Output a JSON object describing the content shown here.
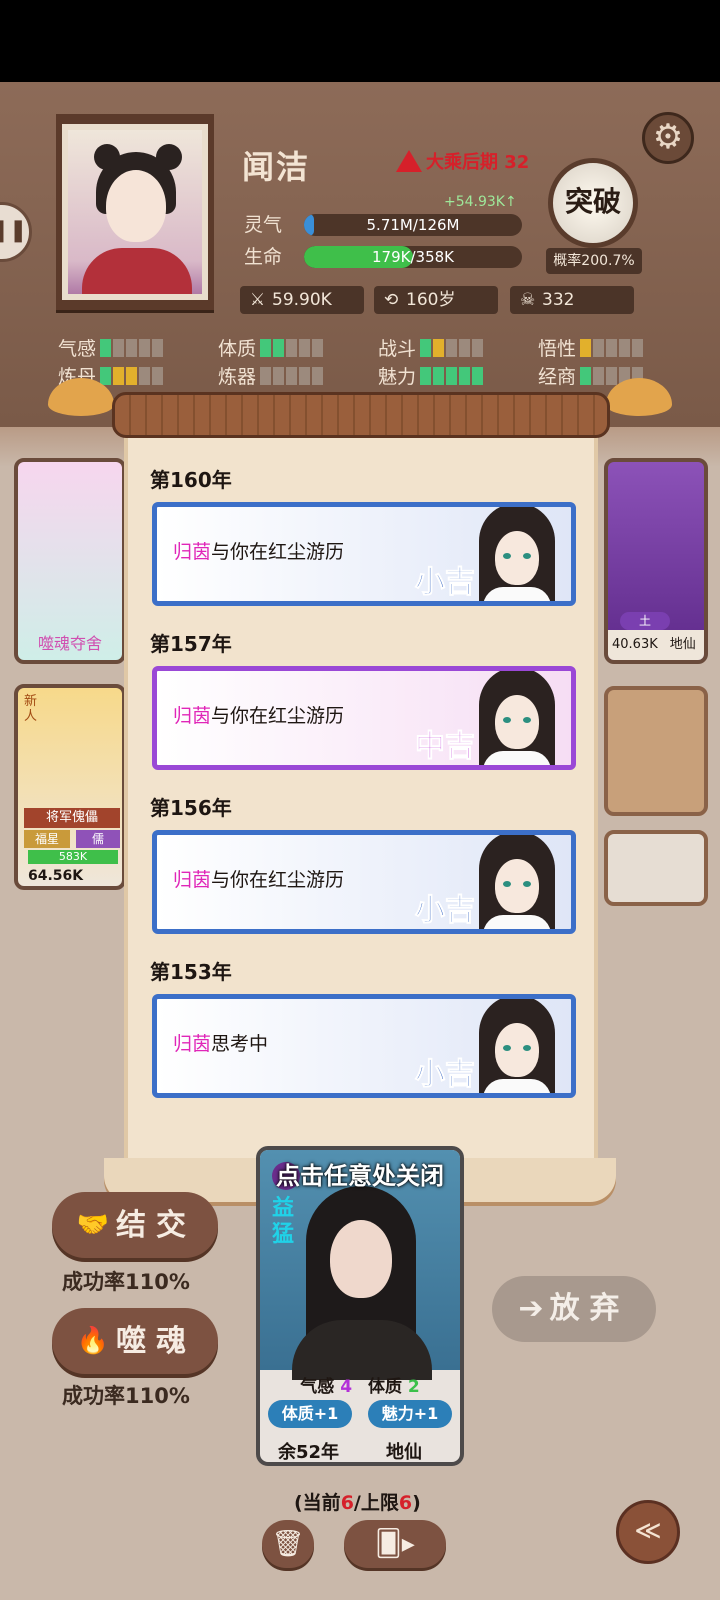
{
  "player": {
    "name": "闻洁",
    "realm": "大乘后期 32",
    "gain": "+54.93K↑",
    "spirit_label": "灵气",
    "spirit_value": "5.71M/126M",
    "spirit_fraction": 0.045,
    "life_label": "生命",
    "life_value": "179K/358K",
    "life_fraction": 0.5,
    "power": "59.90K",
    "age": "160岁",
    "kills": "332"
  },
  "breakthrough": {
    "label": "突破",
    "rate": "概率200.7%"
  },
  "attributes": [
    {
      "label": "气感",
      "levels": [
        "on",
        "off",
        "off",
        "off",
        "off"
      ]
    },
    {
      "label": "体质",
      "levels": [
        "on",
        "on",
        "off",
        "off",
        "off"
      ]
    },
    {
      "label": "战斗",
      "levels": [
        "on",
        "gold",
        "off",
        "off",
        "off"
      ]
    },
    {
      "label": "悟性",
      "levels": [
        "gold",
        "off",
        "off",
        "off",
        "off"
      ]
    },
    {
      "label": "炼丹",
      "levels": [
        "on",
        "gold",
        "gold",
        "off",
        "off"
      ]
    },
    {
      "label": "炼器",
      "levels": [
        "off",
        "off",
        "off",
        "off",
        "off"
      ]
    },
    {
      "label": "魅力",
      "levels": [
        "on",
        "on",
        "on",
        "on",
        "on"
      ]
    },
    {
      "label": "经商",
      "levels": [
        "on",
        "off",
        "off",
        "off",
        "off"
      ]
    }
  ],
  "background_cards": {
    "left_top_caption": "噬魂夺舍",
    "left_bottom_role": "将军傀儡",
    "left_bottom_tag1": "福星",
    "left_bottom_tag2": "儒",
    "left_bottom_badge": "新人",
    "left_bottom_hp": "583K",
    "left_bottom_power": "64.56K",
    "right_top_element": "土",
    "right_top_power": "40.63K",
    "right_top_realm": "地仙"
  },
  "log": [
    {
      "year": "第160年",
      "who": "归茵",
      "text": "与你在红尘游历",
      "luck": "小吉",
      "style": "blue"
    },
    {
      "year": "第157年",
      "who": "归茵",
      "text": "与你在红尘游历",
      "luck": "中吉",
      "style": "purple"
    },
    {
      "year": "第156年",
      "who": "归茵",
      "text": "与你在红尘游历",
      "luck": "小吉",
      "style": "blue"
    },
    {
      "year": "第153年",
      "who": "归茵",
      "text": "思考中",
      "luck": "小吉",
      "style": "blue"
    }
  ],
  "actions": {
    "befriend": "结交",
    "befriend_rate": "成功率110%",
    "devour": "噬魂",
    "devour_rate": "成功率110%",
    "give_up": "放弃"
  },
  "character_card": {
    "close_hint": "点击任意处关闭",
    "name": "益猛",
    "stat1_label": "气感",
    "stat1_value": "4",
    "stat2_label": "体质",
    "stat2_value": "2",
    "tag1": "体质+1",
    "tag2": "魅力+1",
    "remaining": "余52年",
    "realm": "地仙"
  },
  "capacity": {
    "prefix": "(当前",
    "current": "6",
    "mid": "/上限",
    "max": "6",
    "suffix": ")"
  },
  "colors": {
    "accent_brown": "#7d5241",
    "spirit_bar": "#3a8fd8",
    "life_bar": "#3fbf4a",
    "lucky_blue": "#2d5fc0",
    "lucky_purple": "#c03ad6",
    "name_pink": "#e026b8"
  }
}
